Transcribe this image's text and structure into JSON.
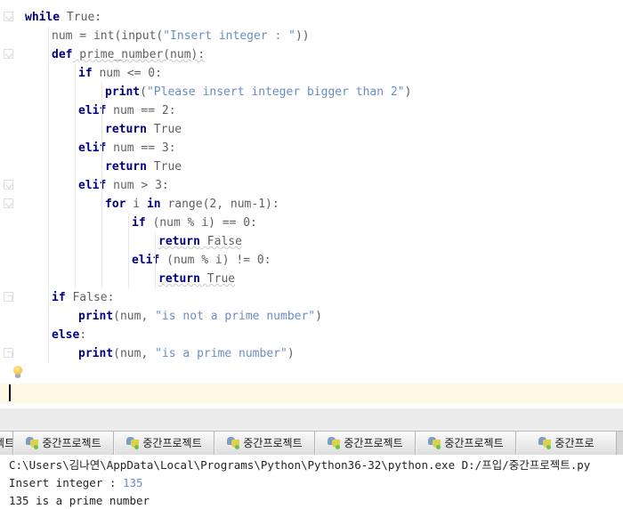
{
  "editor": {
    "language": "python",
    "colors": {
      "keyword": "#000080",
      "string": "#6a8ec4",
      "plain": "#606060",
      "current_line_highlight": "#fdf9e4",
      "caret": "#000000",
      "indent_guide": "#e8e8e8"
    },
    "lines": [
      {
        "indent": 0,
        "tokens": [
          {
            "t": "while",
            "c": "kw"
          },
          {
            "t": " True:",
            "c": "plain"
          }
        ]
      },
      {
        "indent": 1,
        "tokens": [
          {
            "t": "num = int(input(",
            "c": "plain"
          },
          {
            "t": "\"Insert integer : \"",
            "c": "str"
          },
          {
            "t": "))",
            "c": "plain"
          }
        ]
      },
      {
        "indent": 1,
        "tokens": [
          {
            "t": "def",
            "c": "kw"
          },
          {
            "t": " prime_number(num):",
            "c": "plain squiggle"
          }
        ]
      },
      {
        "indent": 2,
        "tokens": [
          {
            "t": "if",
            "c": "kw"
          },
          {
            "t": " num <= 0:",
            "c": "plain"
          }
        ]
      },
      {
        "indent": 3,
        "tokens": [
          {
            "t": "print",
            "c": "kw"
          },
          {
            "t": "(",
            "c": "plain"
          },
          {
            "t": "\"Please insert integer bigger than 2\"",
            "c": "str"
          },
          {
            "t": ")",
            "c": "plain"
          }
        ]
      },
      {
        "indent": 2,
        "tokens": [
          {
            "t": "elif",
            "c": "kw"
          },
          {
            "t": " num == 2:",
            "c": "plain"
          }
        ]
      },
      {
        "indent": 3,
        "tokens": [
          {
            "t": "return",
            "c": "kw"
          },
          {
            "t": " True",
            "c": "plain"
          }
        ]
      },
      {
        "indent": 2,
        "tokens": [
          {
            "t": "elif",
            "c": "kw"
          },
          {
            "t": " num == 3:",
            "c": "plain"
          }
        ]
      },
      {
        "indent": 3,
        "tokens": [
          {
            "t": "return",
            "c": "kw"
          },
          {
            "t": " True",
            "c": "plain"
          }
        ]
      },
      {
        "indent": 2,
        "tokens": [
          {
            "t": "elif",
            "c": "kw"
          },
          {
            "t": " num > 3:",
            "c": "plain"
          }
        ]
      },
      {
        "indent": 3,
        "tokens": [
          {
            "t": "for",
            "c": "kw"
          },
          {
            "t": " i ",
            "c": "plain"
          },
          {
            "t": "in",
            "c": "kw"
          },
          {
            "t": " range(2, num-1):",
            "c": "plain"
          }
        ]
      },
      {
        "indent": 4,
        "tokens": [
          {
            "t": "if",
            "c": "kw"
          },
          {
            "t": " (num % i) == 0:",
            "c": "plain"
          }
        ]
      },
      {
        "indent": 5,
        "tokens": [
          {
            "t": "return",
            "c": "kw squiggle"
          },
          {
            "t": " False",
            "c": "plain squiggle"
          }
        ]
      },
      {
        "indent": 4,
        "tokens": [
          {
            "t": "elif",
            "c": "kw"
          },
          {
            "t": " (num % i) != 0:",
            "c": "plain"
          }
        ]
      },
      {
        "indent": 5,
        "tokens": [
          {
            "t": "return",
            "c": "kw squiggle"
          },
          {
            "t": " True",
            "c": "plain squiggle"
          }
        ]
      },
      {
        "indent": 1,
        "tokens": [
          {
            "t": "if",
            "c": "kw"
          },
          {
            "t": " False:",
            "c": "plain"
          }
        ]
      },
      {
        "indent": 2,
        "tokens": [
          {
            "t": "print",
            "c": "kw"
          },
          {
            "t": "(num, ",
            "c": "plain"
          },
          {
            "t": "\"is not a prime number\"",
            "c": "str"
          },
          {
            "t": ")",
            "c": "plain"
          }
        ]
      },
      {
        "indent": 1,
        "tokens": [
          {
            "t": "else",
            "c": "kw"
          },
          {
            "t": ":",
            "c": "plain"
          }
        ]
      },
      {
        "indent": 2,
        "tokens": [
          {
            "t": "print",
            "c": "kw"
          },
          {
            "t": "(num, ",
            "c": "plain"
          },
          {
            "t": "\"is a prime number\"",
            "c": "str"
          },
          {
            "t": ")",
            "c": "plain"
          }
        ]
      },
      {
        "indent": 0,
        "tokens": []
      }
    ],
    "fold_markers": [
      0,
      2,
      9,
      10,
      15,
      18
    ],
    "current_line_index": 20,
    "caret_line_index": 20,
    "quick_fix_bulb": "lightbulb-icon"
  },
  "tabs": {
    "icon": "python-file-icon",
    "items": [
      {
        "label": "중간프로젝트"
      },
      {
        "label": "중간프로젝트"
      },
      {
        "label": "중간프로젝트"
      },
      {
        "label": "중간프로젝트"
      },
      {
        "label": "중간프로젝트"
      },
      {
        "label": "중간프로젝트"
      },
      {
        "label": "중간프로"
      }
    ]
  },
  "console": {
    "lines": [
      {
        "parts": [
          {
            "t": "C:\\Users\\김나연\\AppData\\Local\\Programs\\Python\\Python36-32\\python.exe D:/프입/중간프로젝트.py",
            "c": "out"
          }
        ]
      },
      {
        "parts": [
          {
            "t": "Insert integer : ",
            "c": "out"
          },
          {
            "t": "135",
            "c": "inval"
          }
        ]
      },
      {
        "parts": [
          {
            "t": "135 is a prime number",
            "c": "out"
          }
        ]
      }
    ]
  }
}
